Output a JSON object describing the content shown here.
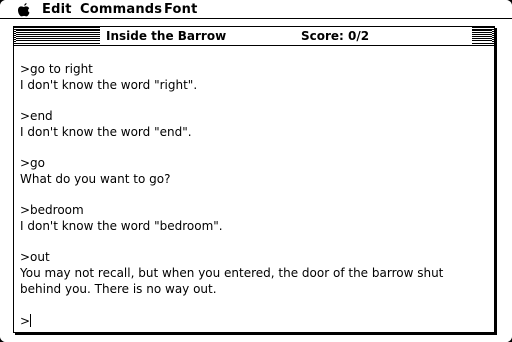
{
  "menubar": {
    "apple_icon": "apple-icon",
    "items": [
      "Edit",
      "Commands",
      "Font"
    ]
  },
  "window": {
    "title": "Inside the Barrow",
    "score_text": "Score: 0/2"
  },
  "transcript": {
    "entries": [
      {
        "command": ">go to right",
        "response": [
          "I don't know the word \"right\"."
        ]
      },
      {
        "command": ">end",
        "response": [
          "I don't know the word \"end\"."
        ]
      },
      {
        "command": ">go",
        "response": [
          "What do you want to go?"
        ]
      },
      {
        "command": ">bedroom",
        "response": [
          "I don't know the word \"bedroom\"."
        ]
      },
      {
        "command": ">out",
        "response": [
          "You may not recall, but when you entered, the door of the barrow shut",
          "behind you. There is no way out."
        ]
      }
    ],
    "prompt": ">"
  }
}
